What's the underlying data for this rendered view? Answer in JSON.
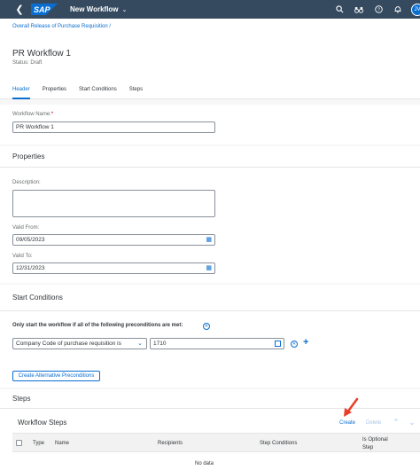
{
  "shell": {
    "back_icon": "back-icon",
    "logo": "SAP",
    "title": "New Workflow",
    "icons": [
      "search-icon",
      "binoculars-icon",
      "help-icon",
      "notification-icon"
    ],
    "avatar_initials": "JV"
  },
  "header": {
    "breadcrumb": "Overall Release of Purchase Requisition /",
    "title": "PR Workflow 1",
    "status": "Status: Draft",
    "tabs": [
      {
        "label": "Header",
        "active": true
      },
      {
        "label": "Properties",
        "active": false
      },
      {
        "label": "Start Conditions",
        "active": false
      },
      {
        "label": "Steps",
        "active": false
      }
    ]
  },
  "general": {
    "workflow_name_label": "Workflow Name:",
    "required_mark": "*",
    "workflow_name_value": "PR Workflow 1"
  },
  "properties": {
    "title": "Properties",
    "description_label": "Description:",
    "description_value": "",
    "valid_from_label": "Valid From:",
    "valid_from_value": "09/05/2023",
    "valid_to_label": "Valid To:",
    "valid_to_value": "12/31/2023"
  },
  "start_conditions": {
    "title": "Start Conditions",
    "precondition_text": "Only start the workflow if all of the following preconditions are met:",
    "condition_field": "Company Code of purchase requisition is",
    "condition_value": "1710",
    "create_alt_label": "Create Alternative Preconditions"
  },
  "steps": {
    "title": "Steps",
    "table_title": "Workflow Steps",
    "create_label": "Create",
    "delete_label": "Delete",
    "columns": [
      "Type",
      "Name",
      "Recipients",
      "Step Conditions",
      "Is Optional Step"
    ],
    "empty_text": "No data"
  },
  "colors": {
    "shell": "#354a5f",
    "accent": "#0a6ed1",
    "annotation_arrow": "#e8402a"
  }
}
